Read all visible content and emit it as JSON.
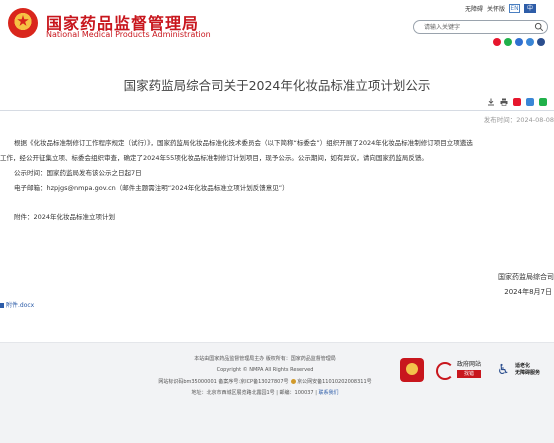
{
  "header": {
    "site_name_cn": "国家药品监督管理局",
    "site_name_en": "National Medical Products Administration",
    "top_links": {
      "accessible": "无障碍",
      "care": "关怀版",
      "lang_en": "EN",
      "lang_cn": "中"
    },
    "search": {
      "placeholder": "请输入关键字"
    },
    "share_icons": [
      "weibo-icon",
      "wechat-icon",
      "mobile-icon",
      "mail-icon",
      "accessibility-icon"
    ]
  },
  "article": {
    "title": "国家药监局综合司关于2024年化妆品标准立项计划公示",
    "tools": [
      "download-icon",
      "print-icon",
      "weibo-share-icon",
      "qq-share-icon",
      "wechat-share-icon"
    ],
    "publish_date": "发布时间：2024-08-08",
    "para1_line1": "根据《化妆品标准制修订工作程序规定（试行）》，国家药监局化妆品标准化技术委员会（以下简称“标委会”）组织开展了2024年化妆品标准制修订项目立项遴选",
    "para1_line2": "工作，经公开征集立项、标委会组织审查，确定了2024年55项化妆品标准制修订计划项目，现予公示。公示期间，如有异议，请向国家药监局反馈。",
    "para2": "公示时间：国家药监局发布该公示之日起7日",
    "para3": "电子邮箱：hzpjgs@nmpa.gov.cn（邮件主题需注明“2024年化妆品标准立项计划反馈意见”）",
    "para4": "附件：2024年化妆品标准立项计划",
    "signature_org": "国家药监局综合司",
    "signature_date": "2024年8月7日",
    "attachment_link": "附件.docx"
  },
  "footer": {
    "line1": "本站由国家药品监督管理局主办 版权所有：国家药品监督管理局",
    "line2": "Copyright © NMPA All Rights Reserved",
    "line3_icp_site": "网站标识码bm35000001",
    "line3_icp": "备案序号:京ICP备13027807号",
    "line3_police": "京公网安备11010202008311号",
    "line4_address": "地址：北京市西城区展览路北露园1号 | 邮编：100037 |",
    "line4_contact": "联系我们",
    "gov_label": "政府网站",
    "gov_error": "找错",
    "access_line1": "适老化",
    "access_line2": "无障碍服务"
  },
  "colors": {
    "brand_red": "#c8161d",
    "link_blue": "#2b5ba8",
    "footer_bg": "#f2f3f5"
  }
}
